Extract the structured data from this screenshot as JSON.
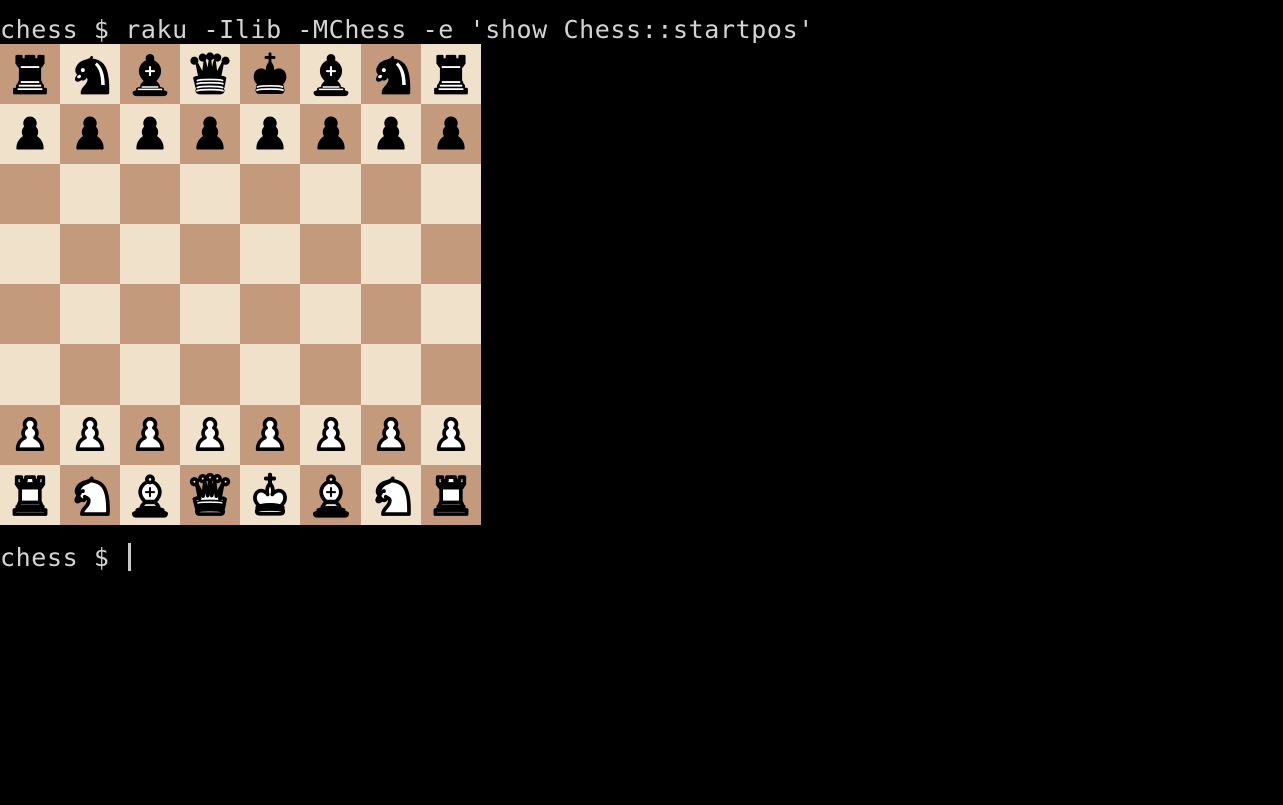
{
  "terminal": {
    "background_color": "#000000",
    "text_color": "#d4d4d4",
    "command_line": "chess $ raku -Ilib -MChess -e 'show Chess::startpos'",
    "prompt_line": "chess $ ",
    "cursor_shape": "vertical-bar"
  },
  "board": {
    "light_square_color": "#f0e2ca",
    "dark_square_color": "#c49a7c",
    "orientation": "white-bottom",
    "square_size_px": 60,
    "files": [
      "a",
      "b",
      "c",
      "d",
      "e",
      "f",
      "g",
      "h"
    ],
    "ranks": [
      "8",
      "7",
      "6",
      "5",
      "4",
      "3",
      "2",
      "1"
    ],
    "fen": "rnbqkbnr/pppppppp/8/8/8/8/PPPPPPPP/RNBQKBNR w KQkq - 0 1",
    "rows": [
      [
        {
          "square": "a8",
          "shade": "dark",
          "piece": "black-rook"
        },
        {
          "square": "b8",
          "shade": "light",
          "piece": "black-knight"
        },
        {
          "square": "c8",
          "shade": "dark",
          "piece": "black-bishop"
        },
        {
          "square": "d8",
          "shade": "light",
          "piece": "black-queen"
        },
        {
          "square": "e8",
          "shade": "dark",
          "piece": "black-king"
        },
        {
          "square": "f8",
          "shade": "light",
          "piece": "black-bishop"
        },
        {
          "square": "g8",
          "shade": "dark",
          "piece": "black-knight"
        },
        {
          "square": "h8",
          "shade": "light",
          "piece": "black-rook"
        }
      ],
      [
        {
          "square": "a7",
          "shade": "light",
          "piece": "black-pawn"
        },
        {
          "square": "b7",
          "shade": "dark",
          "piece": "black-pawn"
        },
        {
          "square": "c7",
          "shade": "light",
          "piece": "black-pawn"
        },
        {
          "square": "d7",
          "shade": "dark",
          "piece": "black-pawn"
        },
        {
          "square": "e7",
          "shade": "light",
          "piece": "black-pawn"
        },
        {
          "square": "f7",
          "shade": "dark",
          "piece": "black-pawn"
        },
        {
          "square": "g7",
          "shade": "light",
          "piece": "black-pawn"
        },
        {
          "square": "h7",
          "shade": "dark",
          "piece": "black-pawn"
        }
      ],
      [
        {
          "square": "a6",
          "shade": "dark",
          "piece": null
        },
        {
          "square": "b6",
          "shade": "light",
          "piece": null
        },
        {
          "square": "c6",
          "shade": "dark",
          "piece": null
        },
        {
          "square": "d6",
          "shade": "light",
          "piece": null
        },
        {
          "square": "e6",
          "shade": "dark",
          "piece": null
        },
        {
          "square": "f6",
          "shade": "light",
          "piece": null
        },
        {
          "square": "g6",
          "shade": "dark",
          "piece": null
        },
        {
          "square": "h6",
          "shade": "light",
          "piece": null
        }
      ],
      [
        {
          "square": "a5",
          "shade": "light",
          "piece": null
        },
        {
          "square": "b5",
          "shade": "dark",
          "piece": null
        },
        {
          "square": "c5",
          "shade": "light",
          "piece": null
        },
        {
          "square": "d5",
          "shade": "dark",
          "piece": null
        },
        {
          "square": "e5",
          "shade": "light",
          "piece": null
        },
        {
          "square": "f5",
          "shade": "dark",
          "piece": null
        },
        {
          "square": "g5",
          "shade": "light",
          "piece": null
        },
        {
          "square": "h5",
          "shade": "dark",
          "piece": null
        }
      ],
      [
        {
          "square": "a4",
          "shade": "dark",
          "piece": null
        },
        {
          "square": "b4",
          "shade": "light",
          "piece": null
        },
        {
          "square": "c4",
          "shade": "dark",
          "piece": null
        },
        {
          "square": "d4",
          "shade": "light",
          "piece": null
        },
        {
          "square": "e4",
          "shade": "dark",
          "piece": null
        },
        {
          "square": "f4",
          "shade": "light",
          "piece": null
        },
        {
          "square": "g4",
          "shade": "dark",
          "piece": null
        },
        {
          "square": "h4",
          "shade": "light",
          "piece": null
        }
      ],
      [
        {
          "square": "a3",
          "shade": "light",
          "piece": null
        },
        {
          "square": "b3",
          "shade": "dark",
          "piece": null
        },
        {
          "square": "c3",
          "shade": "light",
          "piece": null
        },
        {
          "square": "d3",
          "shade": "dark",
          "piece": null
        },
        {
          "square": "e3",
          "shade": "light",
          "piece": null
        },
        {
          "square": "f3",
          "shade": "dark",
          "piece": null
        },
        {
          "square": "g3",
          "shade": "light",
          "piece": null
        },
        {
          "square": "h3",
          "shade": "dark",
          "piece": null
        }
      ],
      [
        {
          "square": "a2",
          "shade": "dark",
          "piece": "white-pawn"
        },
        {
          "square": "b2",
          "shade": "light",
          "piece": "white-pawn"
        },
        {
          "square": "c2",
          "shade": "dark",
          "piece": "white-pawn"
        },
        {
          "square": "d2",
          "shade": "light",
          "piece": "white-pawn"
        },
        {
          "square": "e2",
          "shade": "dark",
          "piece": "white-pawn"
        },
        {
          "square": "f2",
          "shade": "light",
          "piece": "white-pawn"
        },
        {
          "square": "g2",
          "shade": "dark",
          "piece": "white-pawn"
        },
        {
          "square": "h2",
          "shade": "light",
          "piece": "white-pawn"
        }
      ],
      [
        {
          "square": "a1",
          "shade": "light",
          "piece": "white-rook"
        },
        {
          "square": "b1",
          "shade": "dark",
          "piece": "white-knight"
        },
        {
          "square": "c1",
          "shade": "light",
          "piece": "white-bishop"
        },
        {
          "square": "d1",
          "shade": "dark",
          "piece": "white-queen"
        },
        {
          "square": "e1",
          "shade": "light",
          "piece": "white-king"
        },
        {
          "square": "f1",
          "shade": "dark",
          "piece": "white-bishop"
        },
        {
          "square": "g1",
          "shade": "light",
          "piece": "white-knight"
        },
        {
          "square": "h1",
          "shade": "dark",
          "piece": "white-rook"
        }
      ]
    ]
  }
}
